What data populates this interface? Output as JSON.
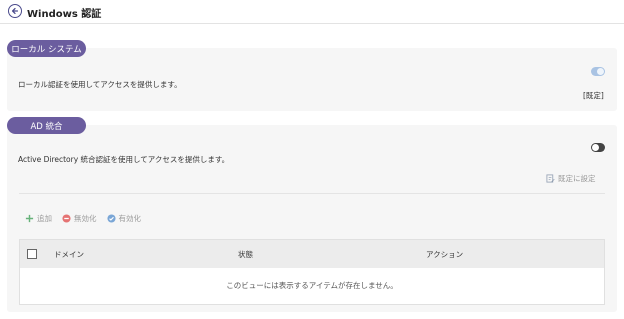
{
  "header": {
    "title": "Windows 認証"
  },
  "local_system": {
    "section_label": "ローカル システム",
    "description": "ローカル認証を使用してアクセスを提供します。",
    "toggle_state": "on",
    "default_badge": "[既定]"
  },
  "ad": {
    "section_label": "AD 統合",
    "description": "Active Directory 統合認証を使用してアクセスを提供します。",
    "toggle_state": "off",
    "set_default_label": "既定に設定",
    "actions": {
      "add_label": "追加",
      "disable_label": "無効化",
      "enable_label": "有効化"
    },
    "table": {
      "columns": [
        "ドメイン",
        "状態",
        "アクション"
      ],
      "rows": [],
      "empty_message": "このビューには表示するアイテムが存在しません。"
    }
  },
  "colors": {
    "accent": "#6b5d9f",
    "add_icon": "#67b27a",
    "disable_icon": "#e57373",
    "enable_icon": "#7aa6d6"
  }
}
